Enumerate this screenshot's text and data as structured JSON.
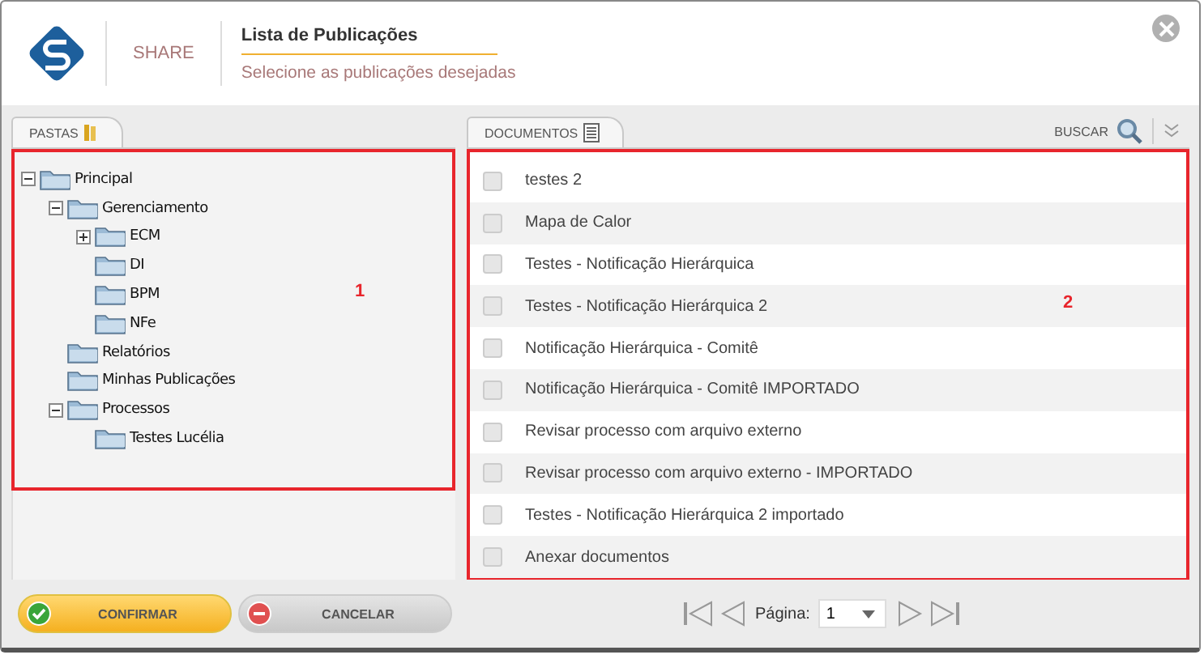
{
  "header": {
    "app_name": "SHARE",
    "title": "Lista de Publicações",
    "subtitle": "Selecione as publicações desejadas"
  },
  "tabs": {
    "left": {
      "label": "PASTAS",
      "selected": true
    },
    "right": {
      "label": "DOCUMENTOS",
      "selected": true
    },
    "search_label": "BUSCAR"
  },
  "folders": [
    {
      "label": "Principal",
      "expanded": true,
      "children": [
        {
          "label": "Gerenciamento",
          "expanded": true,
          "children": [
            {
              "label": "ECM",
              "expanded": false
            },
            {
              "label": "DI"
            },
            {
              "label": "BPM"
            },
            {
              "label": "NFe"
            }
          ]
        },
        {
          "label": "Relatórios"
        },
        {
          "label": "Minhas Publicações"
        },
        {
          "label": "Processos",
          "expanded": true,
          "children": [
            {
              "label": "Testes Lucélia"
            }
          ]
        }
      ]
    }
  ],
  "documents": [
    {
      "label": "testes 2",
      "checked": false
    },
    {
      "label": "Mapa de Calor",
      "checked": false
    },
    {
      "label": "Testes - Notificação Hierárquica",
      "checked": false
    },
    {
      "label": "Testes - Notificação Hierárquica 2",
      "checked": false
    },
    {
      "label": "Notificação Hierárquica - Comitê",
      "checked": false
    },
    {
      "label": "Notificação Hierárquica - Comitê IMPORTADO",
      "checked": false
    },
    {
      "label": "Revisar processo com arquivo externo",
      "checked": false
    },
    {
      "label": "Revisar processo com arquivo externo - IMPORTADO",
      "checked": false
    },
    {
      "label": "Testes - Notificação Hierárquica 2 importado",
      "checked": false
    },
    {
      "label": "Anexar documentos",
      "checked": false
    }
  ],
  "annotations": [
    "1",
    "2"
  ],
  "buttons": {
    "confirm": "CONFIRMAR",
    "cancel": "CANCELAR"
  },
  "pager": {
    "label": "Página:",
    "page": "1"
  }
}
